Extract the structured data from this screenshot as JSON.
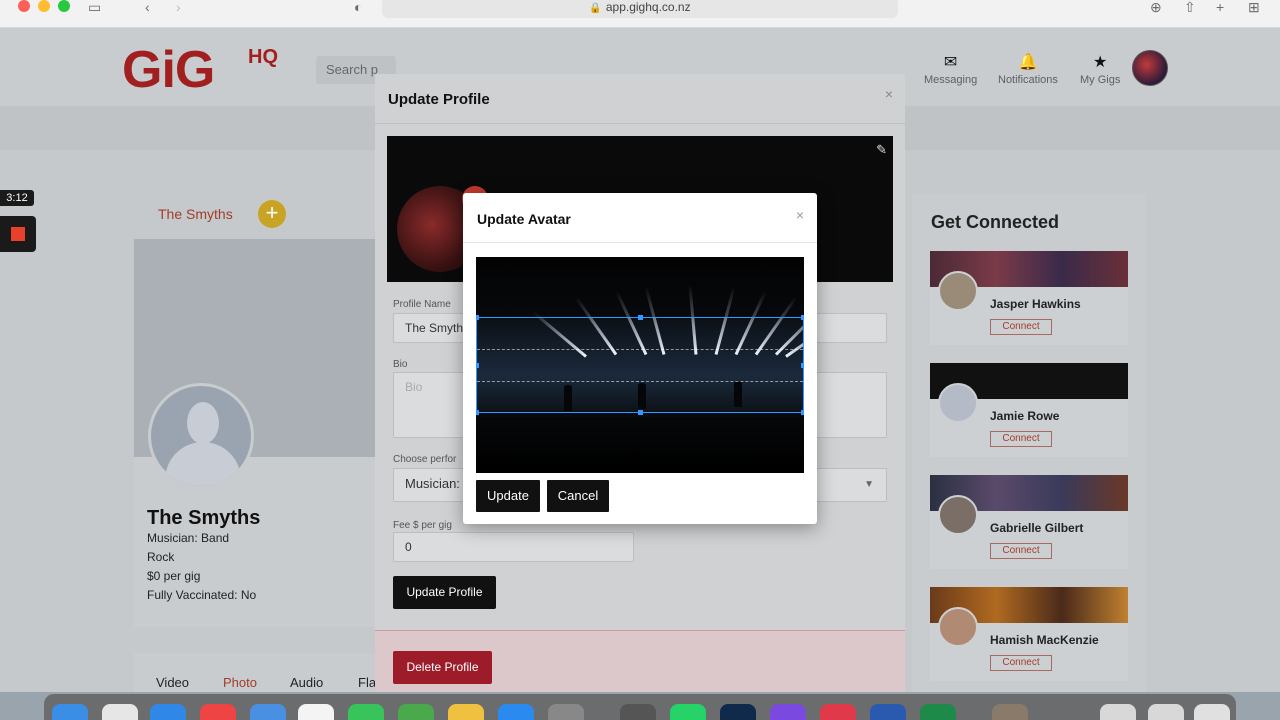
{
  "browser": {
    "url": "app.gighq.co.nz"
  },
  "site": {
    "logo_text": "GiG",
    "logo_suffix": "HQ",
    "search_placeholder": "Search p",
    "nav": [
      {
        "label": "Messaging",
        "icon": "envelope-icon"
      },
      {
        "label": "Notifications",
        "icon": "bell-icon"
      },
      {
        "label": "My Gigs",
        "icon": "star-icon"
      }
    ],
    "band_link": "The Smyths",
    "add_button": "+"
  },
  "profile": {
    "name": "The Smyths",
    "lines": [
      "Musician: Band",
      "Rock",
      "$0 per gig",
      "Fully Vaccinated: No"
    ]
  },
  "tabs": [
    "Video",
    "Photo",
    "Audio",
    "Flattery"
  ],
  "recording": {
    "time": "3:12"
  },
  "connect": {
    "title": "Get Connected",
    "button_label": "Connect",
    "people": [
      {
        "name": "Jasper Hawkins"
      },
      {
        "name": "Jamie Rowe"
      },
      {
        "name": "Gabrielle Gilbert"
      },
      {
        "name": "Hamish MacKenzie"
      }
    ]
  },
  "update_profile_modal": {
    "title": "Update Profile",
    "close": "×",
    "profile_name_label": "Profile Name",
    "profile_name_value": "The Smyth",
    "bio_label": "Bio",
    "bio_placeholder": "Bio",
    "perform_label": "Choose perfor",
    "perform_value": "Musician:",
    "fee_label": "Fee $ per gig",
    "fee_value": "0",
    "update_button": "Update Profile",
    "delete_button": "Delete Profile"
  },
  "update_avatar_modal": {
    "title": "Update Avatar",
    "close": "×",
    "update_button": "Update",
    "cancel_button": "Cancel"
  },
  "colors": {
    "brand_red": "#a21f1f",
    "accent_gold": "#c9a424",
    "danger": "#9c1c2a",
    "crop_blue": "#3399ff"
  }
}
